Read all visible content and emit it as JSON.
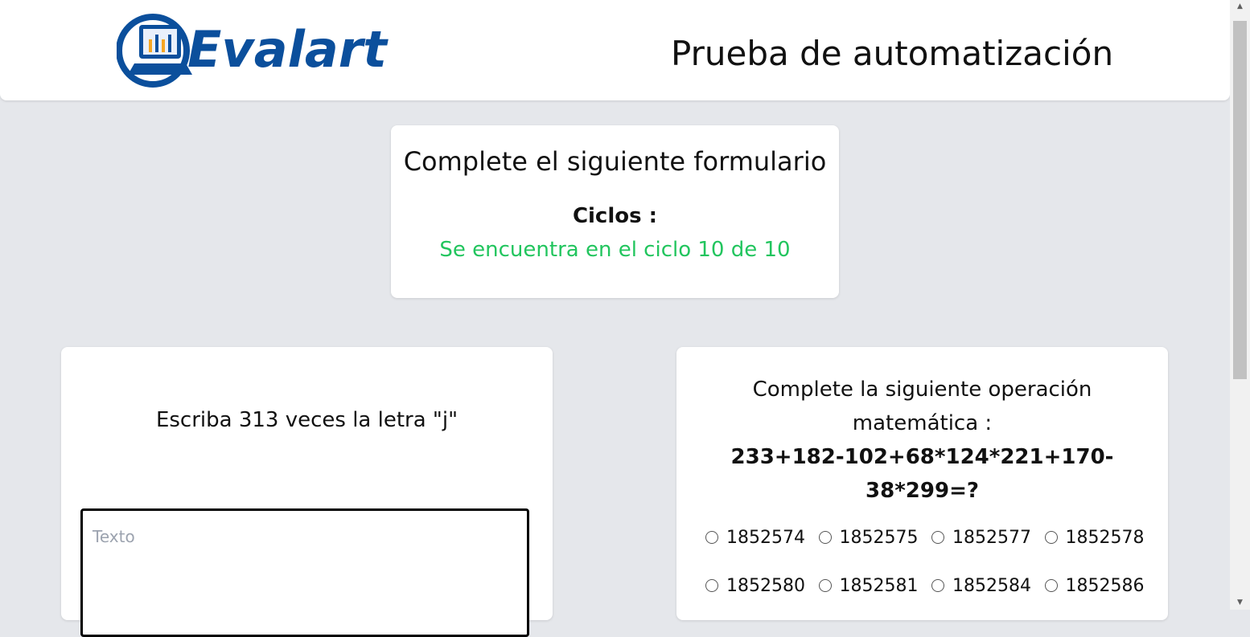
{
  "header": {
    "logo_text": "Evalart",
    "title": "Prueba de automatización"
  },
  "cycle_card": {
    "heading": "Complete el siguiente formulario",
    "cycles_label": "Ciclos :",
    "cycles_status": "Se encuentra en el ciclo 10 de 10",
    "status_color": "#22c55e"
  },
  "text_task": {
    "instruction": "Escriba 313 veces la letra \"j\"",
    "input_placeholder": "Texto",
    "input_value": ""
  },
  "math_task": {
    "title": "Complete la siguiente operación matemática :",
    "expression": "233+182-102+68*124*221+170-38*299=?",
    "options": [
      "1852574",
      "1852575",
      "1852577",
      "1852578",
      "1852580",
      "1852581",
      "1852584",
      "1852586"
    ]
  },
  "colors": {
    "background": "#e5e7eb",
    "card": "#ffffff",
    "brand_blue": "#0b4f9c"
  }
}
